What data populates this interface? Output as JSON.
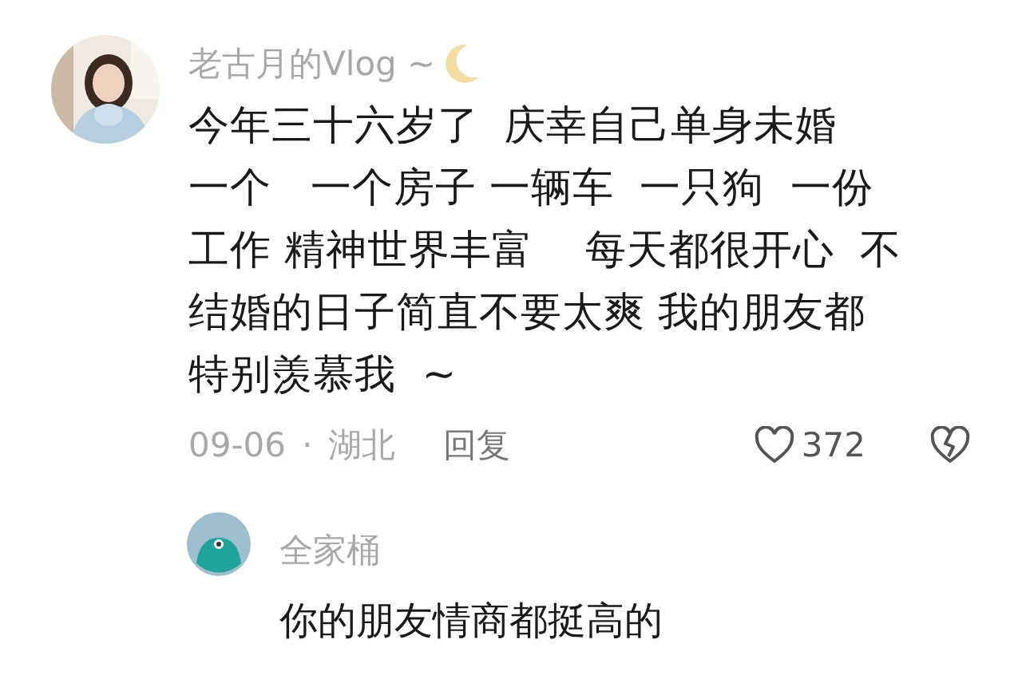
{
  "comment": {
    "author": "老古月的Vlog ~",
    "lines": [
      "今年三十六岁了  庆幸自己单身未婚",
      "一个   一个房子 一辆车  一只狗  一份",
      "工作 精神世界丰富    每天都很开心  不",
      "结婚的日子简直不要太爽 我的朋友都",
      "特别羡慕我  ~"
    ],
    "date": "09-06",
    "separator": "·",
    "location": "湖北",
    "reply_label": "回复",
    "likes": "372",
    "liked": false
  },
  "reply": {
    "author": "全家桶",
    "text": "你的朋友情商都挺高的"
  }
}
